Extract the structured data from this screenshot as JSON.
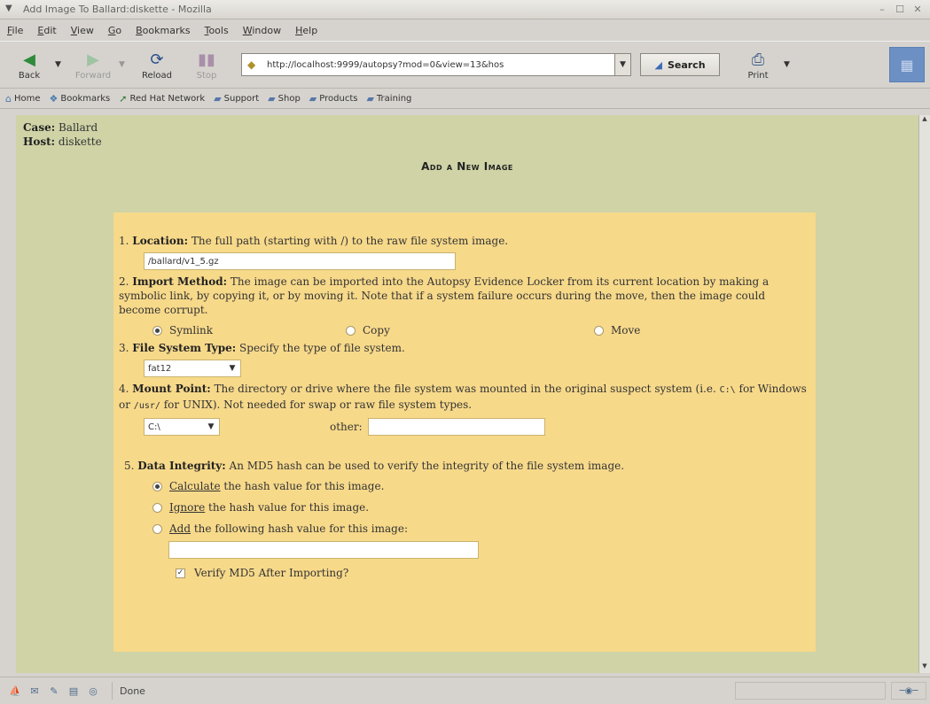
{
  "window": {
    "title": "Add Image To Ballard:diskette - Mozilla"
  },
  "menubar": [
    {
      "label": "File",
      "u": "F",
      "rest": "ile"
    },
    {
      "label": "Edit",
      "u": "E",
      "rest": "dit"
    },
    {
      "label": "View",
      "u": "V",
      "rest": "iew"
    },
    {
      "label": "Go",
      "u": "G",
      "rest": "o"
    },
    {
      "label": "Bookmarks",
      "u": "B",
      "rest": "ookmarks"
    },
    {
      "label": "Tools",
      "u": "T",
      "rest": "ools"
    },
    {
      "label": "Window",
      "u": "W",
      "rest": "indow"
    },
    {
      "label": "Help",
      "u": "H",
      "rest": "elp"
    }
  ],
  "nav": {
    "back": "Back",
    "forward": "Forward",
    "reload": "Reload",
    "stop": "Stop",
    "url": "http://localhost:9999/autopsy?mod=0&view=13&hos",
    "search": "Search",
    "print": "Print"
  },
  "bookmarks": [
    "Home",
    "Bookmarks",
    "Red Hat Network",
    "Support",
    "Shop",
    "Products",
    "Training"
  ],
  "page": {
    "case_label": "Case:",
    "case_value": "Ballard",
    "host_label": "Host:",
    "host_value": "diskette",
    "title": "Add a New Image"
  },
  "form": {
    "location": {
      "num": "1.",
      "label": "Location:",
      "text": "The full path (starting with /) to the raw file system image.",
      "value": "/ballard/v1_5.gz"
    },
    "import": {
      "num": "2.",
      "label": "Import Method:",
      "text": "The image can be imported into the Autopsy Evidence Locker from its current location by making a symbolic link, by copying it, or by moving it. Note that if a system failure occurs during the move, then the image could become corrupt.",
      "options": [
        "Symlink",
        "Copy",
        "Move"
      ],
      "selected": "Symlink"
    },
    "fstype": {
      "num": "3.",
      "label": "File System Type:",
      "text": "Specify the type of file system.",
      "value": "fat12"
    },
    "mount": {
      "num": "4.",
      "label": "Mount Point:",
      "text_a": "The directory or drive where the file system was mounted in the original suspect system (i.e.",
      "code_a": "C:\\",
      "text_b": "for Windows or",
      "code_b": "/usr/",
      "text_c": "for UNIX). Not needed for swap or raw file system types.",
      "value": "C:\\",
      "other_label": "other:",
      "other_value": ""
    },
    "integrity": {
      "num": "5.",
      "label": "Data Integrity:",
      "text": "An MD5 hash can be used to verify the integrity of the file system image.",
      "opt1_link": "Calculate",
      "opt1_rest": "the hash value for this image.",
      "opt2_link": "Ignore",
      "opt2_rest": "the hash value for this image.",
      "opt3_link": "Add",
      "opt3_rest": "the following hash value for this image:",
      "hash_value": "",
      "verify_label": "Verify MD5 After Importing?",
      "verify_checked": true
    }
  },
  "status": {
    "text": "Done"
  },
  "colors": {
    "page_bg": "#cfd3a6",
    "form_bg": "#f7d98a",
    "chrome": "#d6d3ce"
  }
}
